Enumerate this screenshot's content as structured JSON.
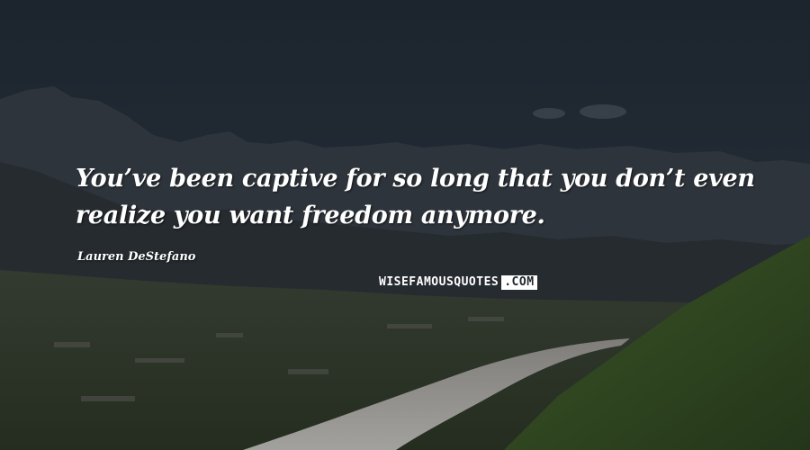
{
  "quote": {
    "text": "You’ve been captive for so long that you don’t even realize you want freedom anymore.",
    "author": "Lauren DeStefano"
  },
  "watermark": {
    "main": "WISEFAMOUSQUOTES",
    "tld": ".COM"
  },
  "colors": {
    "sky": "#1f2731",
    "mountains": "#2b3036",
    "valley": "#2d3a26",
    "hillside": "#2f4a1f",
    "road": "#8d8b87",
    "text": "#ffffff"
  }
}
